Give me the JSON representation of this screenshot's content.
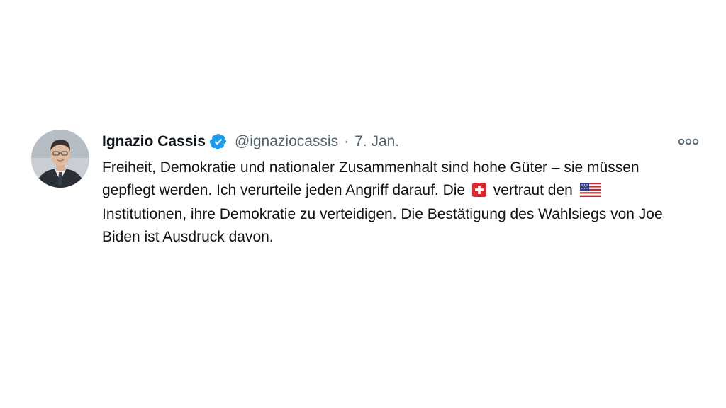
{
  "tweet": {
    "author_name": "Ignazio Cassis",
    "verified_icon": "verified-badge-icon",
    "handle": "@ignaziocassis",
    "separator": "·",
    "date": "7. Jan.",
    "text_part1": "Freiheit, Demokratie und nationaler Zusammenhalt sind hohe Güter – sie müssen gepflegt werden. Ich verurteile jeden Angriff darauf. Die",
    "flag1": "swiss-flag-icon",
    "text_part2": "vertraut den",
    "flag2": "us-flag-icon",
    "text_part3": "Institutionen, ihre Demokratie zu verteidigen. Die Bestätigung des Wahlsiegs von Joe Biden ist Ausdruck davon.",
    "more_icon": "more-options-icon"
  },
  "colors": {
    "verified_blue": "#1d9bf0",
    "secondary_text": "#536471",
    "primary_text": "#0f1419"
  }
}
